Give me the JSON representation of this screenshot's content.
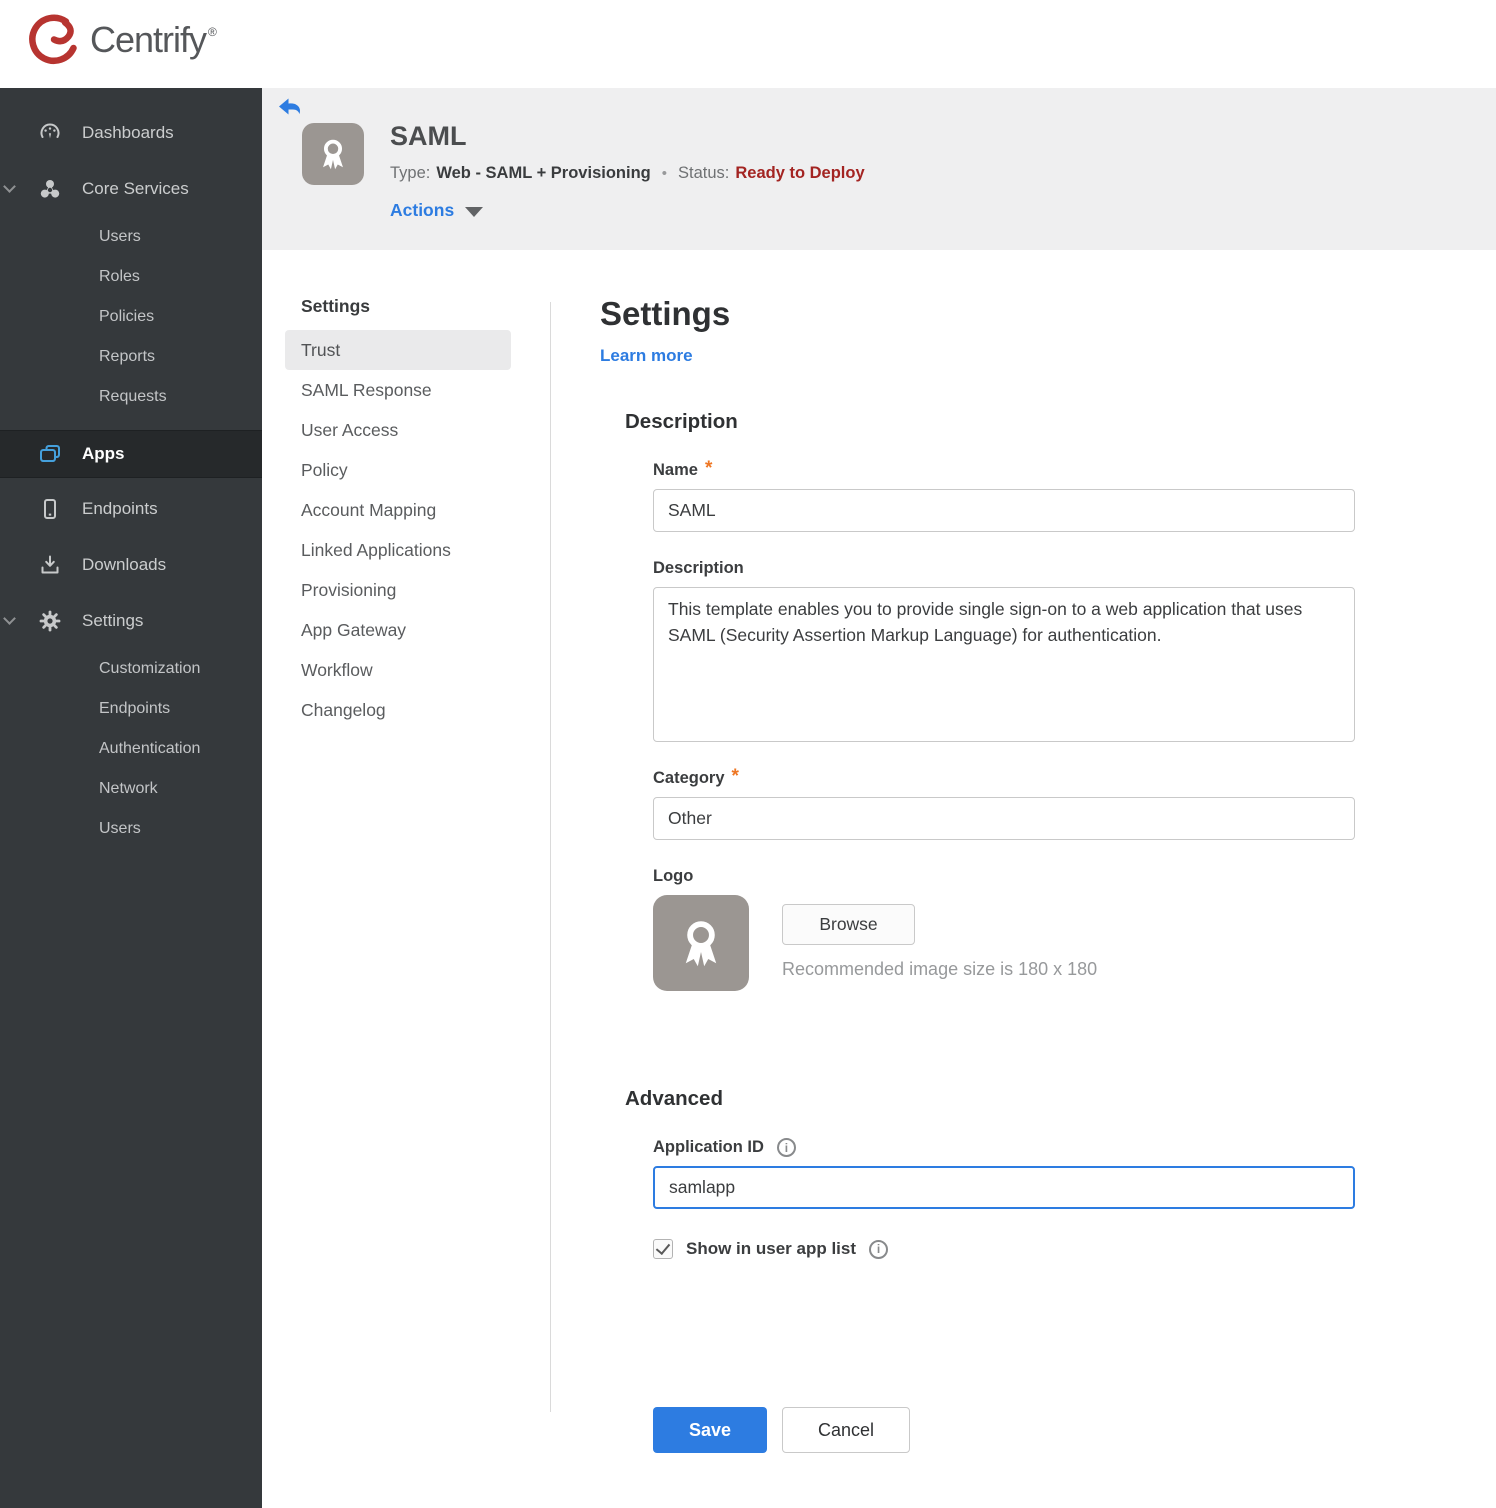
{
  "brand": {
    "name": "Centrify",
    "trademark": "®"
  },
  "sidebar": {
    "dashboards": "Dashboards",
    "core_services": "Core Services",
    "core_children": [
      "Users",
      "Roles",
      "Policies",
      "Reports",
      "Requests"
    ],
    "apps": "Apps",
    "endpoints": "Endpoints",
    "downloads": "Downloads",
    "settings": "Settings",
    "settings_children": [
      "Customization",
      "Endpoints",
      "Authentication",
      "Network",
      "Users"
    ]
  },
  "header": {
    "title": "SAML",
    "type_label": "Type:",
    "type_value": "Web - SAML + Provisioning",
    "bullet": "•",
    "status_label": "Status:",
    "status_value": "Ready to Deploy",
    "actions_label": "Actions"
  },
  "subnav": {
    "section": "Settings",
    "selected": "Trust",
    "items": [
      "Trust",
      "SAML Response",
      "User Access",
      "Policy",
      "Account Mapping",
      "Linked Applications",
      "Provisioning",
      "App Gateway",
      "Workflow",
      "Changelog"
    ]
  },
  "main": {
    "title": "Settings",
    "learn_more": "Learn more",
    "required_marker": "*",
    "info_glyph": "i",
    "description_heading": "Description",
    "name_label": "Name",
    "name_value": "SAML",
    "description_label": "Description",
    "description_value": "This template enables you to provide single sign-on to a web application that uses SAML (Security Assertion Markup Language) for authentication.",
    "category_label": "Category",
    "category_value": "Other",
    "logo_label": "Logo",
    "browse_label": "Browse",
    "logo_hint": "Recommended image size is 180 x 180",
    "advanced_heading": "Advanced",
    "app_id_label": "Application ID",
    "app_id_value": "samlapp",
    "show_in_app_list_label": "Show in user app list",
    "checkbox_checked": true,
    "save_label": "Save",
    "cancel_label": "Cancel"
  },
  "icons": {
    "brand": "centrify-swirl-icon",
    "dashboards": "gauge-icon",
    "core_services": "trefoil-icon",
    "apps": "stacked-windows-icon",
    "endpoints": "mobile-phone-icon",
    "downloads": "download-icon",
    "settings": "gear-icon",
    "back": "back-arrow-icon",
    "app_logo": "ribbon-badge-icon",
    "actions_caret": "caret-down-icon",
    "expanded_sections": "chevron-down-icon",
    "info": "info-icon"
  },
  "colors": {
    "accent_blue": "#2d7ce1",
    "apps_icon_blue": "#45a0dc",
    "status_red": "#a32422",
    "required_orange": "#ee7623",
    "brand_red": "#b73430",
    "sidebar_bg": "#35393c",
    "sidebar_active_bg": "#26292b",
    "header_bg": "#efeff0",
    "selected_nav_bg": "#eaeaeb",
    "input_border": "#c9c9c9"
  }
}
